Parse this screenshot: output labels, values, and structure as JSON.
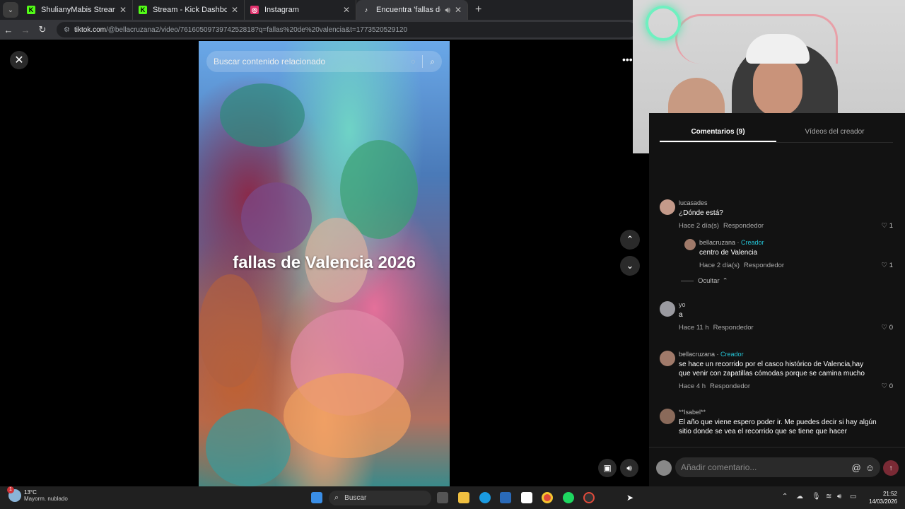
{
  "browser": {
    "tabs": [
      {
        "title": "ShulianyMabis Stream - Watch",
        "fav": "K",
        "color": "#53fc18"
      },
      {
        "title": "Stream - Kick Dashboard",
        "fav": "K",
        "color": "#53fc18"
      },
      {
        "title": "Instagram",
        "fav": "◎",
        "color": "#e1306c"
      },
      {
        "title": "Encuentra 'fallas de valencia",
        "fav": "♪",
        "color": "#ffffff"
      }
    ],
    "url_domain": "tiktok.com",
    "url_path": "/@bellacruzana2/video/7616050973974252818?q=fallas%20de%20valencia&t=1773520529120"
  },
  "video": {
    "search_placeholder": "Buscar contenido relacionado",
    "caption": "fallas de Valencia 2026"
  },
  "comments_panel": {
    "tab_comments": "Comentarios (9)",
    "tab_creator_videos": "Vídeos del creador",
    "hide_label": "Ocultar",
    "comments": [
      {
        "user": "lucasades",
        "creator": "",
        "text": "¿Dónde está?",
        "time": "Hace 2 día(s)",
        "reply": "Respondedor",
        "likes": "1"
      },
      {
        "user": "bellacruzana",
        "creator": "Creador",
        "text": "centro de Valencia",
        "time": "Hace 2 día(s)",
        "reply": "Respondedor",
        "likes": "1"
      },
      {
        "user": "yo",
        "creator": "",
        "text": "a",
        "time": "Hace 11 h",
        "reply": "Respondedor",
        "likes": "0"
      },
      {
        "user": "bellacruzana",
        "creator": "Creador",
        "text": "se hace un recorrido por el casco histórico de Valencia,hay que venir con zapatillas cómodas porque se camina mucho",
        "time": "Hace 4 h",
        "reply": "Respondedor",
        "likes": "0"
      },
      {
        "user": "**Isabel**",
        "creator": "",
        "text": "El año que viene espero poder ir. Me puedes decir si hay algún sitio donde se vea el recorrido que se tiene que hacer",
        "time": "",
        "reply": "",
        "likes": ""
      }
    ],
    "compose_placeholder": "Añadir comentario..."
  },
  "taskbar": {
    "temperature": "13°C",
    "weather": "Mayorm. nublado",
    "weather_badge": "1",
    "search_label": "Buscar",
    "time": "21:52",
    "date": "14/03/2026"
  }
}
